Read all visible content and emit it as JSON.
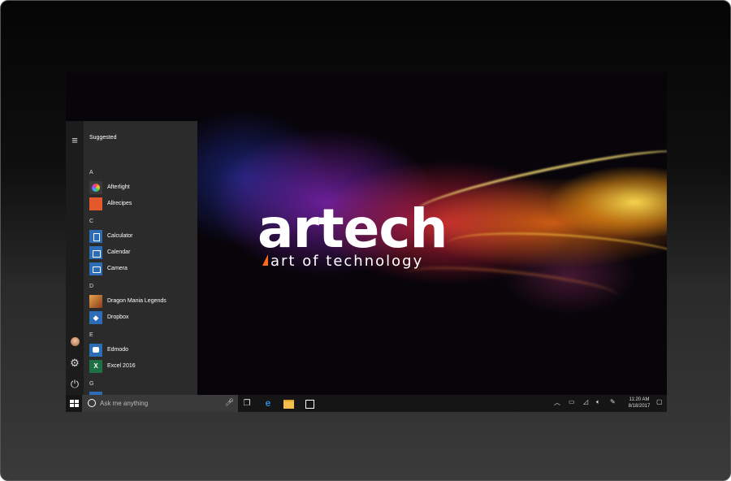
{
  "wallpaper": {
    "brand_name": "artech",
    "brand_tagline": "art of technology",
    "accent_color": "#ff6a1a"
  },
  "start_menu": {
    "header": "Suggested",
    "sections": [
      {
        "letter": "A",
        "apps": [
          {
            "label": "Afterlight",
            "icon": "afterlight-icon",
            "color": "#3a3a3a"
          },
          {
            "label": "Allrecipes",
            "icon": "allrecipes-icon",
            "color": "#e3592b"
          }
        ]
      },
      {
        "letter": "C",
        "apps": [
          {
            "label": "Calculator",
            "icon": "calculator-icon",
            "color": "#2d6db5"
          },
          {
            "label": "Calendar",
            "icon": "calendar-icon",
            "color": "#2d6db5"
          },
          {
            "label": "Camera",
            "icon": "camera-icon",
            "color": "#2d6db5"
          }
        ]
      },
      {
        "letter": "D",
        "apps": [
          {
            "label": "Dragon Mania Legends",
            "icon": "dragon-icon",
            "color": "#b8632a"
          },
          {
            "label": "Dropbox",
            "icon": "dropbox-icon",
            "color": "#2d6db5"
          }
        ]
      },
      {
        "letter": "E",
        "apps": [
          {
            "label": "Edmodo",
            "icon": "edmodo-icon",
            "color": "#2d6db5"
          },
          {
            "label": "Excel 2016",
            "icon": "excel-icon",
            "color": "#1e7145"
          }
        ]
      },
      {
        "letter": "G",
        "apps": []
      }
    ],
    "rail_icons": [
      "hamburger-icon",
      "avatar",
      "gear-icon",
      "power-icon"
    ]
  },
  "taskbar": {
    "search_placeholder": "Ask me anything",
    "clock_time": "11:20 AM",
    "clock_date": "8/18/2017"
  }
}
